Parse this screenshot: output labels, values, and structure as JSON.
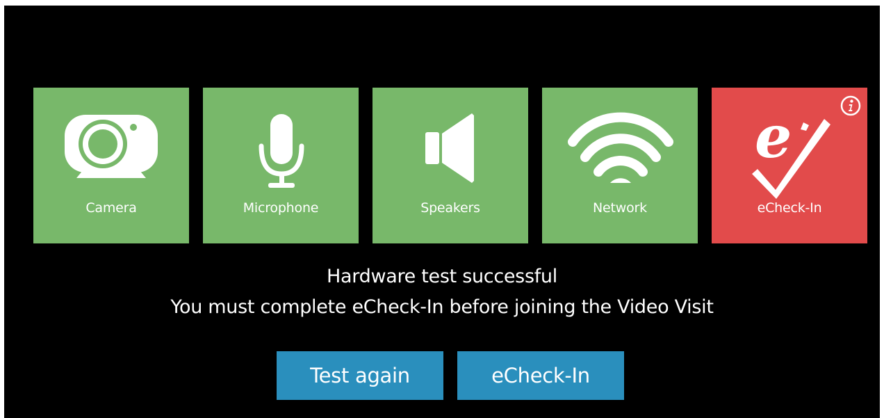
{
  "tiles": [
    {
      "label": "Camera",
      "icon": "camera-icon",
      "status": "success"
    },
    {
      "label": "Microphone",
      "icon": "microphone-icon",
      "status": "success"
    },
    {
      "label": "Speakers",
      "icon": "speaker-icon",
      "status": "success"
    },
    {
      "label": "Network",
      "icon": "wifi-icon",
      "status": "success"
    },
    {
      "label": "eCheck-In",
      "icon": "echeckin-icon",
      "status": "pending"
    }
  ],
  "colors": {
    "success": "#78b86a",
    "pending": "#e24b4b",
    "button": "#2a8fbd",
    "background": "#000000"
  },
  "status": {
    "line1": "Hardware test successful",
    "line2": "You must complete eCheck-In before joining the Video Visit"
  },
  "buttons": {
    "test_again": "Test again",
    "echeckin": "eCheck-In"
  }
}
